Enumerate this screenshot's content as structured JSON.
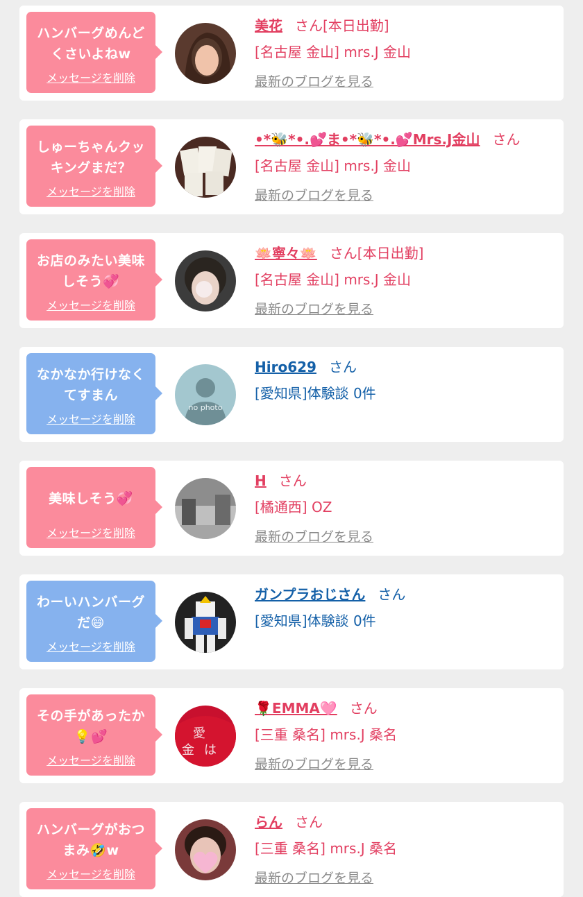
{
  "colors": {
    "pink_bubble": "#fb8b9c",
    "blue_bubble": "#86b2ee",
    "pink_text": "#e23e60",
    "blue_text": "#1460a8",
    "blog_link": "#8a8a8a"
  },
  "messages": [
    {
      "bubble": "pink",
      "text": "ハンバーグめんどくさいよねw",
      "delete_label": "メッセージを削除",
      "name": "美花",
      "honorific": "さん[本日出勤]",
      "shop": "[名古屋 金山] mrs.J 金山",
      "blog_label": "最新のブログを見る",
      "avatar": "woman-photo-avatar"
    },
    {
      "bubble": "pink",
      "text": "しゅーちゃんクッキングまだ？",
      "delete_label": "メッセージを削除",
      "name": "•*🐝*•.💕ま•*🐝*•.💕Mrs.J金山",
      "honorific": "さん",
      "shop": "[名古屋 金山] mrs.J 金山",
      "blog_label": "最新のブログを見る",
      "avatar": "cards-photo-avatar"
    },
    {
      "bubble": "pink",
      "text": "お店のみたい美味しそう💞",
      "delete_label": "メッセージを削除",
      "name": "🪷寧々🪷",
      "honorific": "さん[本日出勤]",
      "shop": "[名古屋 金山] mrs.J 金山",
      "blog_label": "最新のブログを見る",
      "avatar": "blurred-face-avatar"
    },
    {
      "bubble": "blue",
      "text": "なかなか行けなくてすまん",
      "delete_label": "メッセージを削除",
      "name": "Hiro629",
      "honorific": "さん",
      "shop": "[愛知県]体験談 0件",
      "blog_label": "",
      "avatar": "no-photo-avatar",
      "avatar_text": "no photo"
    },
    {
      "bubble": "pink",
      "text": "美味しそう💞",
      "delete_label": "メッセージを削除",
      "name": "H",
      "honorific": "さん",
      "shop": "[橘通西] OZ",
      "blog_label": "最新のブログを見る",
      "avatar": "street-photo-avatar"
    },
    {
      "bubble": "blue",
      "text": "わーいハンバーグだ😄",
      "delete_label": "メッセージを削除",
      "name": "ガンプラおじさん",
      "honorific": "さん",
      "shop": "[愛知県]体験談 0件",
      "blog_label": "",
      "avatar": "robot-model-avatar"
    },
    {
      "bubble": "pink",
      "text": "その手があったか💡💕",
      "delete_label": "メッセージを削除",
      "name": "🌹EMMA🩷",
      "honorific": "さん",
      "shop": "[三重 桑名] mrs.J 桑名",
      "blog_label": "最新のブログを見る",
      "avatar": "red-shirt-avatar"
    },
    {
      "bubble": "pink",
      "text": "ハンバーグがおつまみ🤣w",
      "delete_label": "メッセージを削除",
      "name": "らん",
      "honorific": "さん",
      "shop": "[三重 桑名] mrs.J 桑名",
      "blog_label": "最新のブログを見る",
      "avatar": "heart-covered-face-avatar"
    }
  ]
}
